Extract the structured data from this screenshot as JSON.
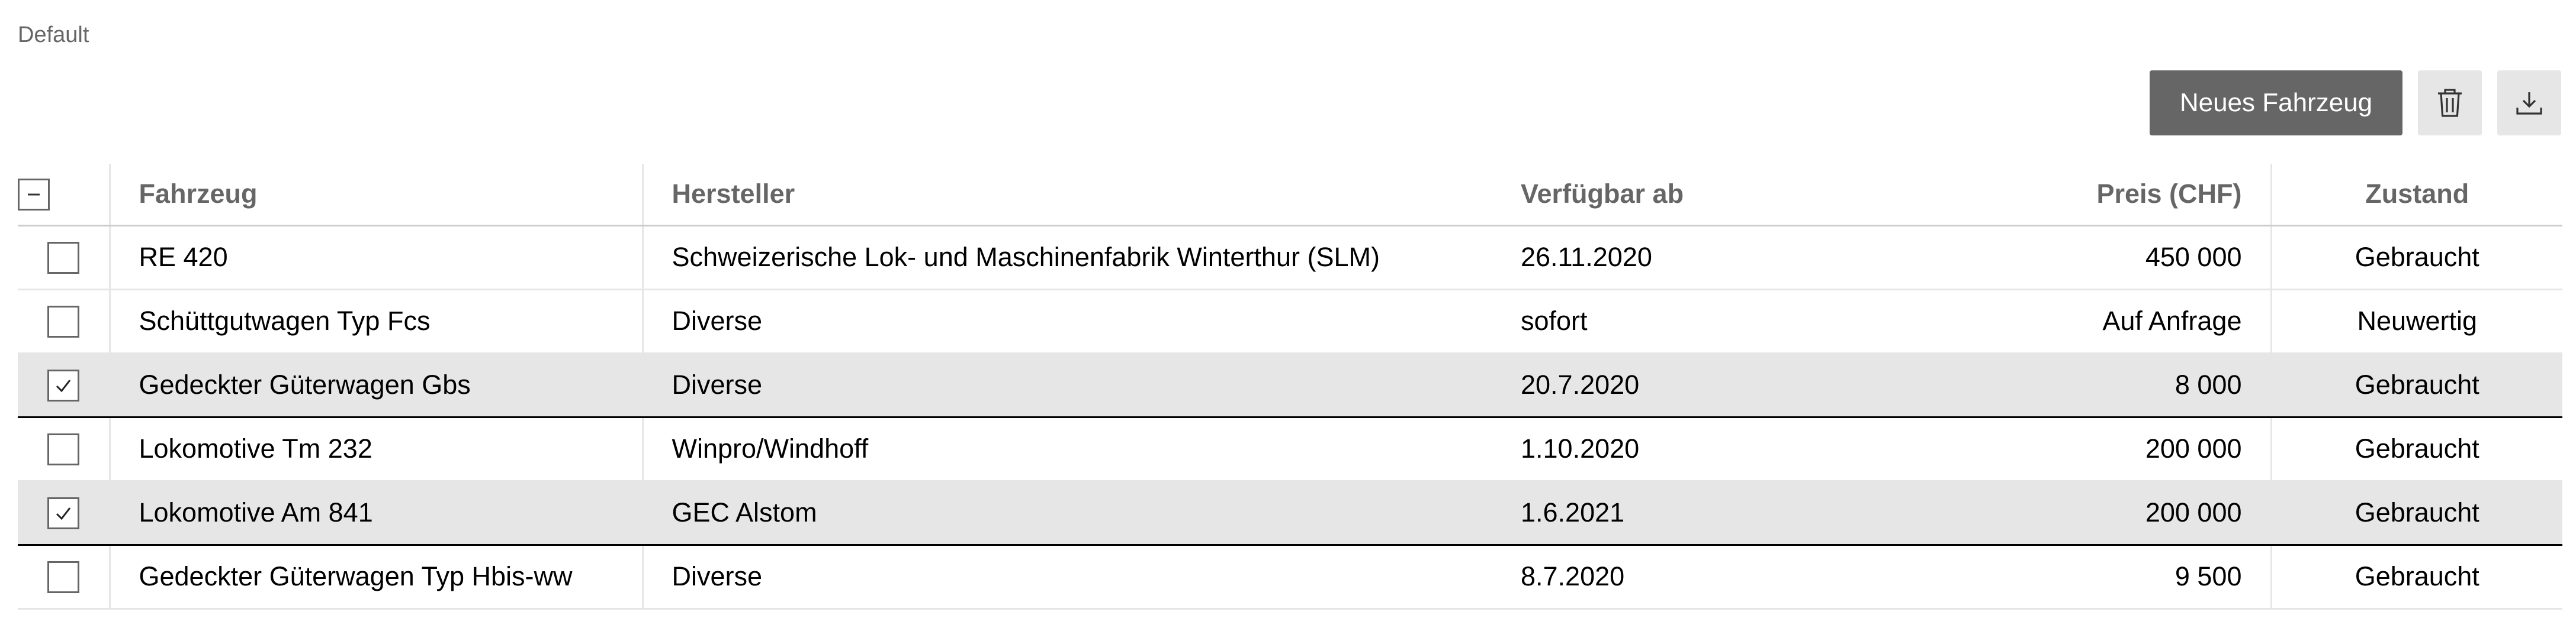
{
  "page": {
    "caption": "Default"
  },
  "toolbar": {
    "new_vehicle_label": "Neues Fahrzeug",
    "delete_icon": "trash-icon",
    "download_icon": "download-icon"
  },
  "table": {
    "select_all_state": "indeterminate",
    "headers": {
      "vehicle": "Fahrzeug",
      "manufacturer": "Hersteller",
      "available_from": "Verfügbar ab",
      "price": "Preis (CHF)",
      "condition": "Zustand"
    },
    "rows": [
      {
        "checked": false,
        "vehicle": "RE 420",
        "manufacturer": "Schweizerische Lok- und Maschinenfabrik Winterthur (SLM)",
        "available_from": "26.11.2020",
        "price": "450 000",
        "condition": "Gebraucht"
      },
      {
        "checked": false,
        "vehicle": "Schüttgutwagen Typ Fcs",
        "manufacturer": "Diverse",
        "available_from": "sofort",
        "price": "Auf Anfrage",
        "condition": "Neuwertig"
      },
      {
        "checked": true,
        "vehicle": "Gedeckter Güterwagen Gbs",
        "manufacturer": "Diverse",
        "available_from": "20.7.2020",
        "price": "8 000",
        "condition": "Gebraucht"
      },
      {
        "checked": false,
        "vehicle": "Lokomotive Tm 232",
        "manufacturer": "Winpro/Windhoff",
        "available_from": "1.10.2020",
        "price": "200 000",
        "condition": "Gebraucht"
      },
      {
        "checked": true,
        "vehicle": "Lokomotive Am 841",
        "manufacturer": "GEC Alstom",
        "available_from": "1.6.2021",
        "price": "200 000",
        "condition": "Gebraucht"
      },
      {
        "checked": false,
        "vehicle": "Gedeckter Güterwagen Typ Hbis-ww",
        "manufacturer": "Diverse",
        "available_from": "8.7.2020",
        "price": "9 500",
        "condition": "Gebraucht"
      }
    ]
  }
}
